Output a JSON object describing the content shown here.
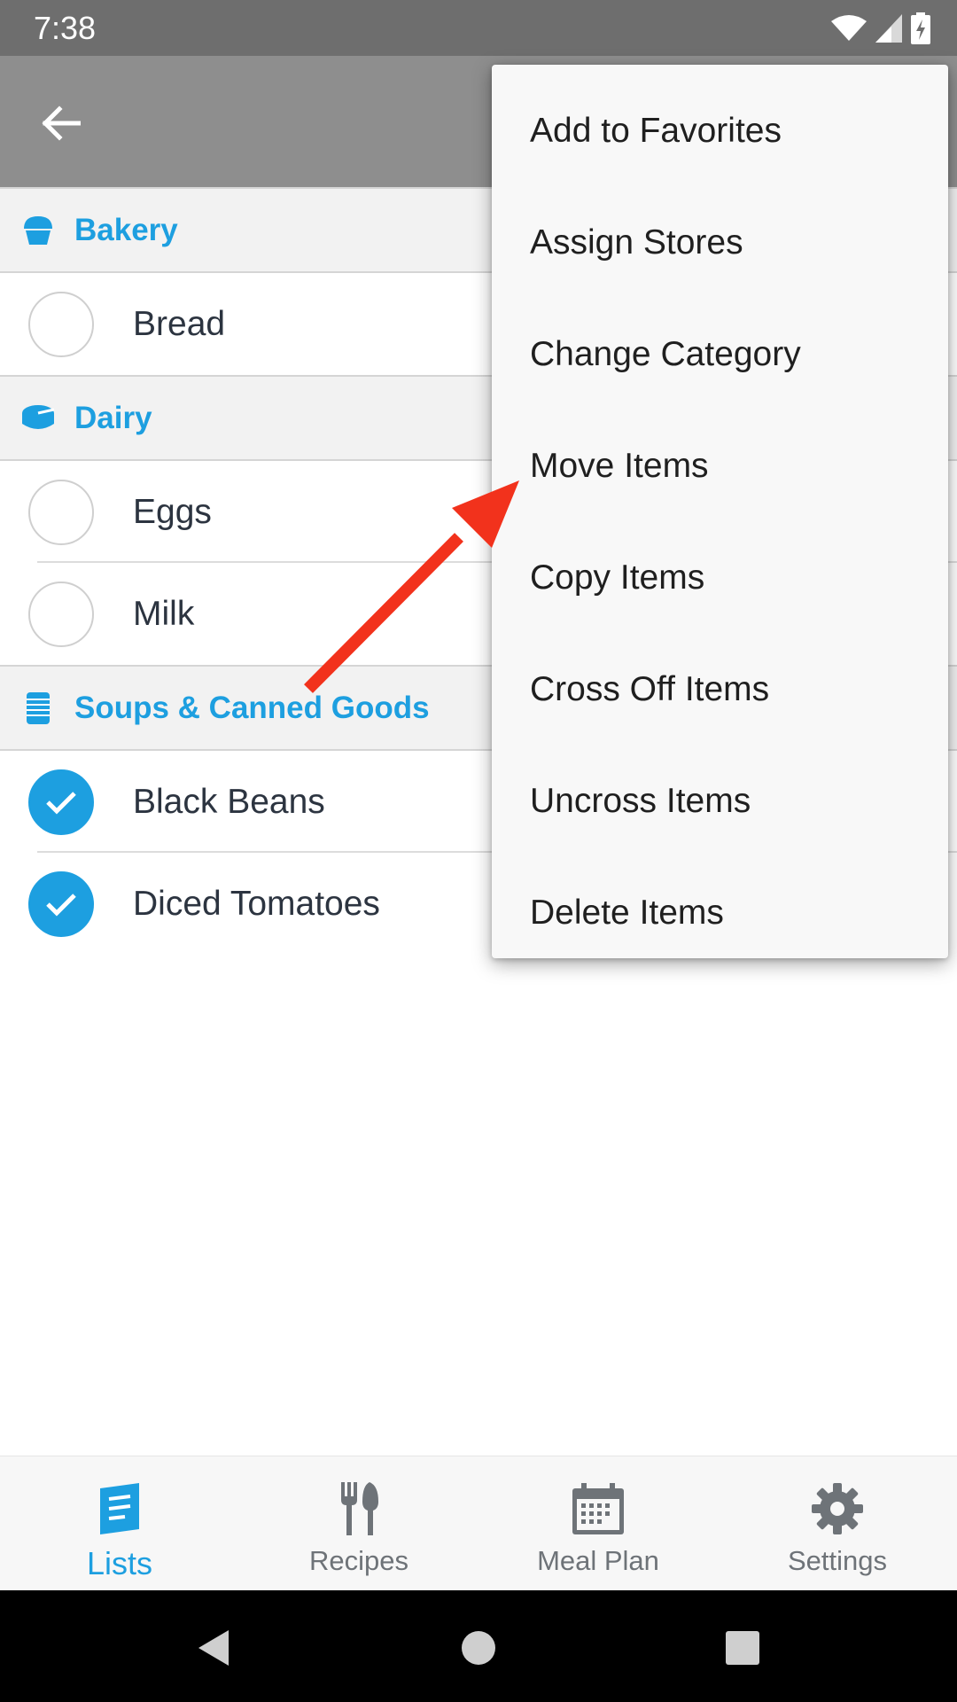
{
  "status_bar": {
    "time": "7:38",
    "icons": [
      "wifi-icon",
      "cell-signal-icon",
      "battery-charging-icon"
    ]
  },
  "app_bar": {
    "back_icon": "arrow-back-icon"
  },
  "colors": {
    "accent": "#1d9fe0",
    "app_bar": "#8e8e8e",
    "status_bar": "#6e6e6e",
    "arrow": "#f2321c"
  },
  "categories": [
    {
      "name": "Bakery",
      "icon": "cupcake-icon",
      "items": [
        {
          "label": "Bread",
          "checked": false
        }
      ]
    },
    {
      "name": "Dairy",
      "icon": "cheese-icon",
      "items": [
        {
          "label": "Eggs",
          "checked": false
        },
        {
          "label": "Milk",
          "checked": false
        }
      ]
    },
    {
      "name": "Soups & Canned Goods",
      "icon": "can-icon",
      "items": [
        {
          "label": "Black Beans",
          "checked": true
        },
        {
          "label": "Diced Tomatoes",
          "checked": true
        }
      ]
    }
  ],
  "menu": {
    "items": [
      "Add to Favorites",
      "Assign Stores",
      "Change Category",
      "Move Items",
      "Copy Items",
      "Cross Off Items",
      "Uncross Items",
      "Delete Items"
    ]
  },
  "bottom_nav": {
    "tabs": [
      {
        "label": "Lists",
        "icon": "list-icon",
        "active": true
      },
      {
        "label": "Recipes",
        "icon": "fork-spoon-icon",
        "active": false
      },
      {
        "label": "Meal Plan",
        "icon": "calendar-icon",
        "active": false
      },
      {
        "label": "Settings",
        "icon": "gear-icon",
        "active": false
      }
    ]
  },
  "system_nav": {
    "buttons": [
      "back-triangle-icon",
      "home-circle-icon",
      "recents-square-icon"
    ]
  }
}
